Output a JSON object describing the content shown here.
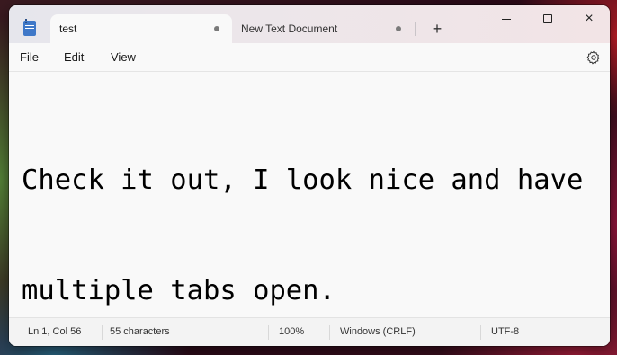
{
  "tabs": [
    {
      "label": "test",
      "active": true,
      "unsaved": true
    },
    {
      "label": "New Text Document",
      "active": false,
      "unsaved": true
    }
  ],
  "new_tab_label": "+",
  "window_controls": {
    "minimize": "minimize",
    "maximize": "maximize",
    "close": "×"
  },
  "menu": {
    "items": [
      "File",
      "Edit",
      "View"
    ],
    "settings_icon": "gear-icon"
  },
  "editor": {
    "lines": [
      "Check it out, I look nice and have",
      "multiple tabs open."
    ]
  },
  "status": {
    "position": "Ln 1, Col 56",
    "characters": "55 characters",
    "zoom": "100%",
    "line_ending": "Windows (CRLF)",
    "encoding": "UTF-8"
  },
  "colors": {
    "accent_icon": "#3f78c8",
    "editor_bg": "#f9f9f9",
    "statusbar_bg": "#f3f3f3"
  }
}
